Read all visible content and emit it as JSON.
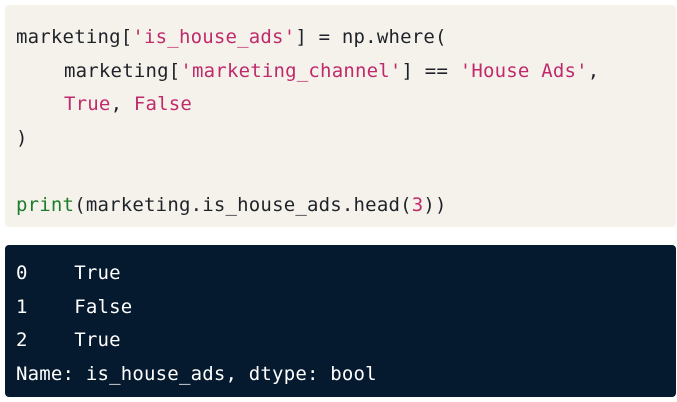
{
  "code": {
    "line1": {
      "a": "marketing[",
      "str": "'is_house_ads'",
      "b": "] = np.where("
    },
    "line2": {
      "a": "marketing[",
      "str1": "'marketing_channel'",
      "b": "] == ",
      "str2": "'House Ads'",
      "c": ","
    },
    "line3": {
      "kw1": "True",
      "sep": ", ",
      "kw2": "False"
    },
    "line4": ")",
    "line6": {
      "fn": "print",
      "a": "(marketing.is_house_ads.head(",
      "num": "3",
      "b": "))"
    }
  },
  "output": {
    "rows": [
      {
        "index": "0",
        "value": "True"
      },
      {
        "index": "1",
        "value": "False"
      },
      {
        "index": "2",
        "value": "True"
      }
    ],
    "footer": "Name: is_house_ads, dtype: bool"
  },
  "colors": {
    "code_bg": "#f5f2ec",
    "output_bg": "#051a2e",
    "string": "#c02a6b",
    "function": "#1b7d2a"
  }
}
